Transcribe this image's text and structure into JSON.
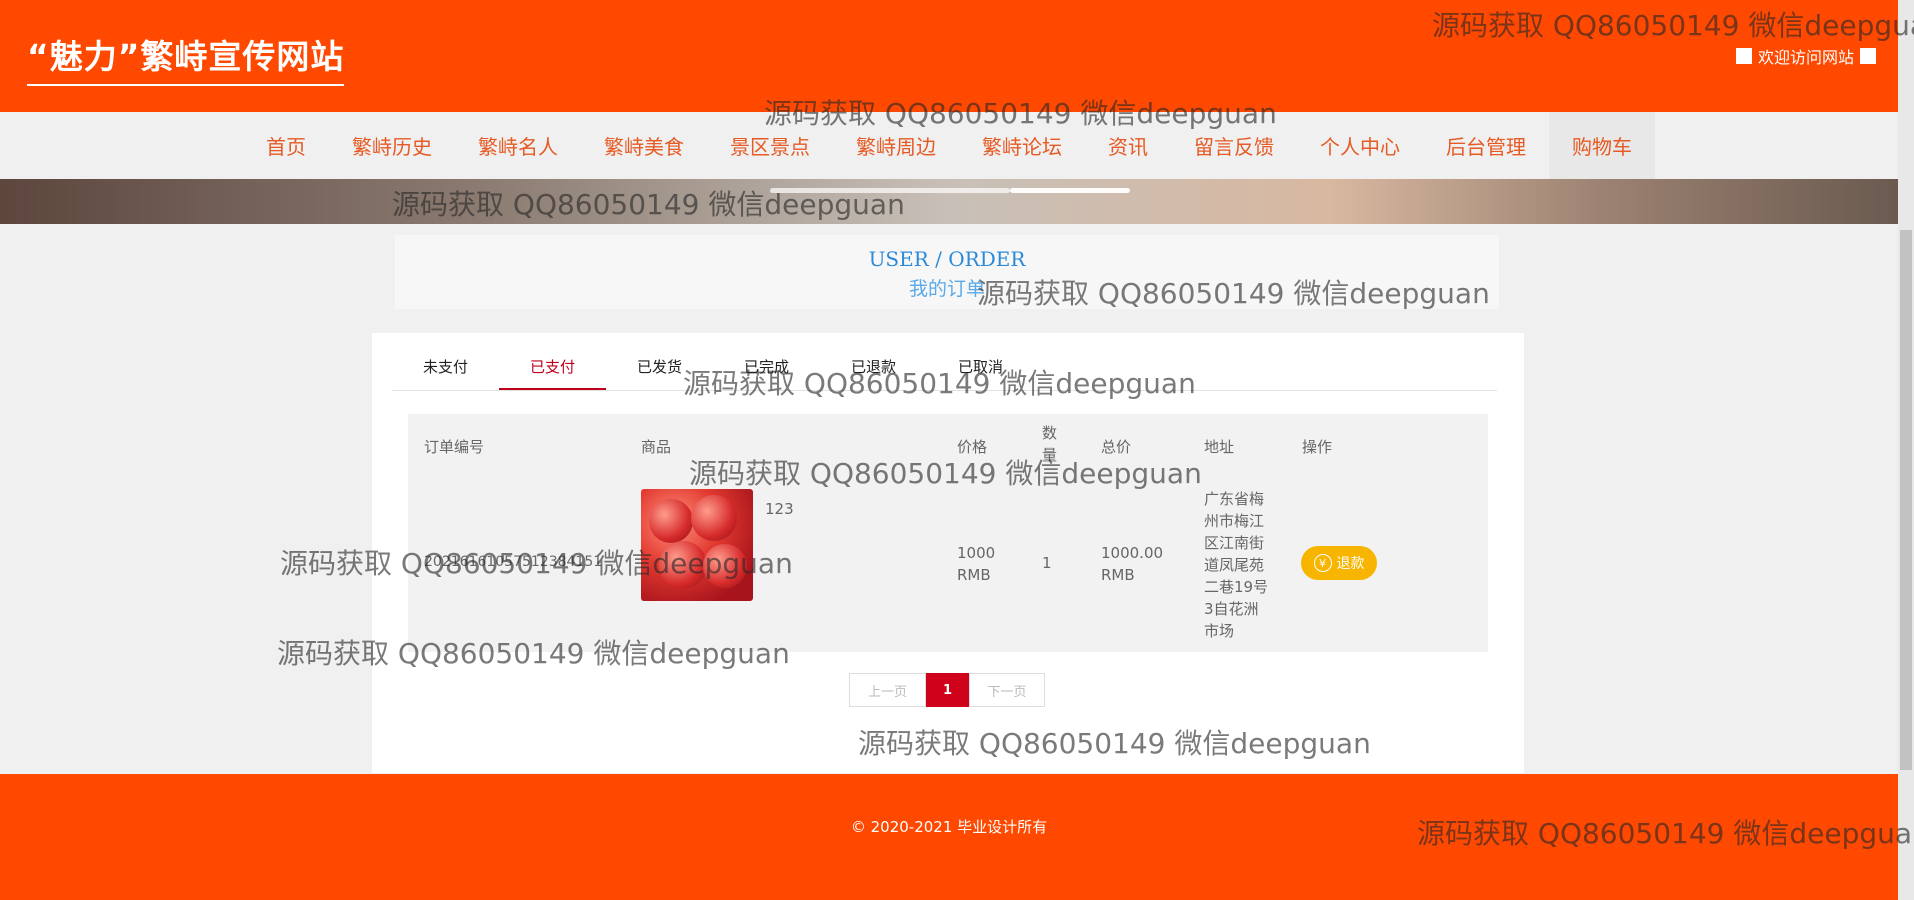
{
  "header": {
    "site_title": "“魅力”繁峙宣传网站",
    "welcome_text": "欢迎访问网站"
  },
  "nav": {
    "items": [
      "首页",
      "繁峙历史",
      "繁峙名人",
      "繁峙美食",
      "景区景点",
      "繁峙周边",
      "繁峙论坛",
      "资讯",
      "留言反馈",
      "个人中心",
      "后台管理",
      "购物车"
    ],
    "active": "购物车"
  },
  "page_title": {
    "en": "USER / ORDER",
    "cn": "我的订单"
  },
  "tabs": {
    "items": [
      "未支付",
      "已支付",
      "已发货",
      "已完成",
      "已退款",
      "已取消"
    ],
    "active": "已支付"
  },
  "table": {
    "headers": {
      "order_no": "订单编号",
      "product": "商品",
      "price": "价格",
      "qty": "数量",
      "total": "总价",
      "address": "地址",
      "action": "操作"
    },
    "rows": [
      {
        "order_no": "20216161057512384151",
        "product_name": "123",
        "price": "1000 RMB",
        "qty": "1",
        "total": "1000.00 RMB",
        "address": "广东省梅州市梅江区江南街道凤尾苑二巷19号3自花洲市场",
        "action": "退款"
      }
    ]
  },
  "pagination": {
    "prev": "上一页",
    "current": "1",
    "next": "下一页"
  },
  "footer": {
    "copyright": "© 2020-2021 毕业设计所有"
  },
  "watermark": "源码获取 QQ86050149 微信deepguan",
  "colors": {
    "brand": "#ff4800",
    "nav_text": "#e65a24",
    "active_tab": "#c0001a",
    "refund_button": "#f7b500",
    "pager_current": "#d0021b",
    "title_en": "#2b8ad8"
  }
}
